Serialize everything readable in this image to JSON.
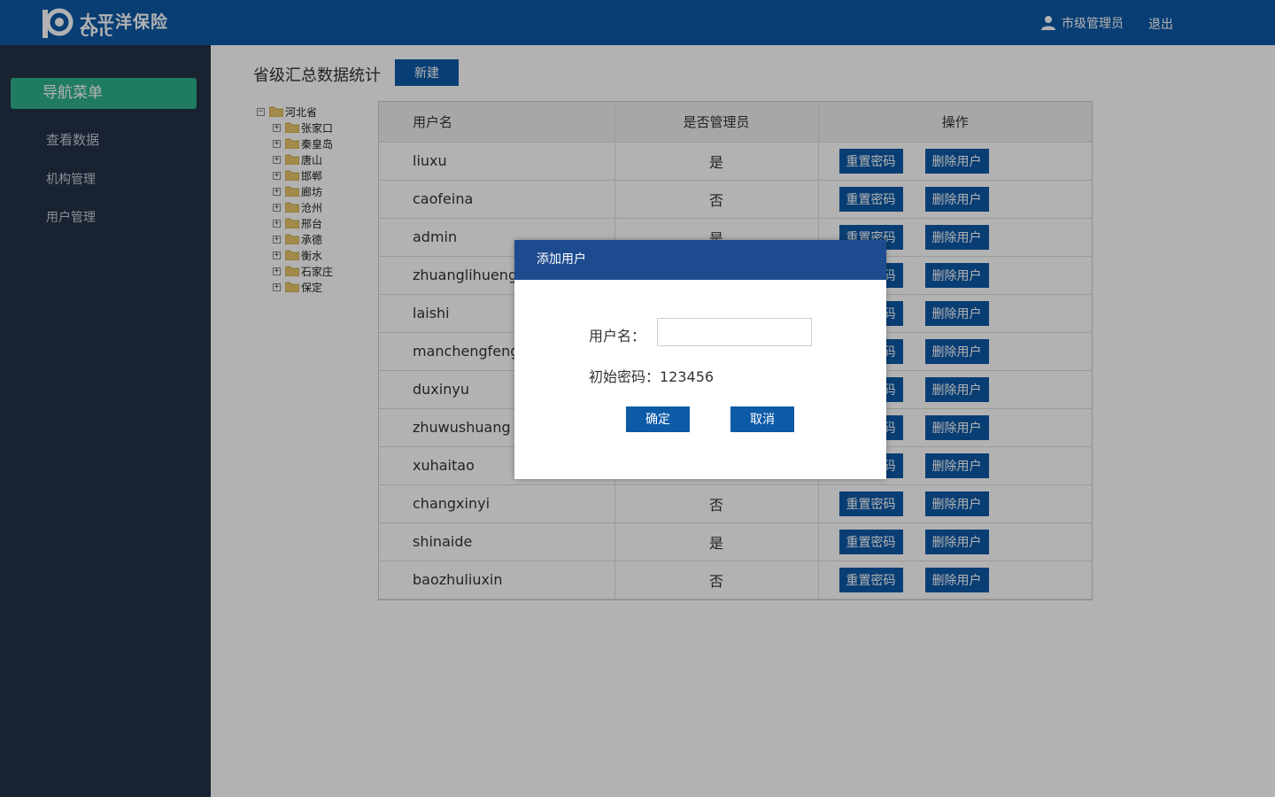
{
  "header": {
    "logo_cn": "太平洋保险",
    "logo_en": "CPIC",
    "user_label": "市级管理员",
    "logout_label": "退出"
  },
  "sidebar": {
    "title": "导航菜单",
    "items": [
      {
        "label": "查看数据"
      },
      {
        "label": "机构管理"
      },
      {
        "label": "用户管理"
      }
    ]
  },
  "main": {
    "title": "省级汇总数据统计",
    "new_label": "新建"
  },
  "tree": {
    "root": "河北省",
    "children": [
      "张家口",
      "秦皇岛",
      "唐山",
      "邯郸",
      "廊坊",
      "沧州",
      "邢台",
      "承德",
      "衡水",
      "石家庄",
      "保定"
    ]
  },
  "table": {
    "headers": {
      "name": "用户名",
      "admin": "是否管理员",
      "ops": "操作"
    },
    "reset_label": "重置密码",
    "delete_label": "删除用户",
    "rows": [
      {
        "name": "liuxu",
        "admin": "是"
      },
      {
        "name": "caofeina",
        "admin": "否"
      },
      {
        "name": "admin",
        "admin": "是"
      },
      {
        "name": "zhuanglihueng",
        "admin": ""
      },
      {
        "name": "laishi",
        "admin": ""
      },
      {
        "name": "manchengfeng",
        "admin": ""
      },
      {
        "name": "duxinyu",
        "admin": ""
      },
      {
        "name": "zhuwushuang",
        "admin": ""
      },
      {
        "name": "xuhaitao",
        "admin": ""
      },
      {
        "name": "changxinyi",
        "admin": "否"
      },
      {
        "name": "shinaide",
        "admin": "是"
      },
      {
        "name": "baozhuliuxin",
        "admin": "否"
      }
    ]
  },
  "modal": {
    "title": "添加用户",
    "username_label": "用户名：",
    "username_value": "",
    "password_text": "初始密码：123456",
    "ok_label": "确定",
    "cancel_label": "取消"
  },
  "colors": {
    "header_bg": "#0d5aa7",
    "sidebar_bg": "#233146",
    "nav_active": "#2fb28b",
    "button_bg": "#0d5aa7",
    "modal_head": "#1d4b8f"
  }
}
